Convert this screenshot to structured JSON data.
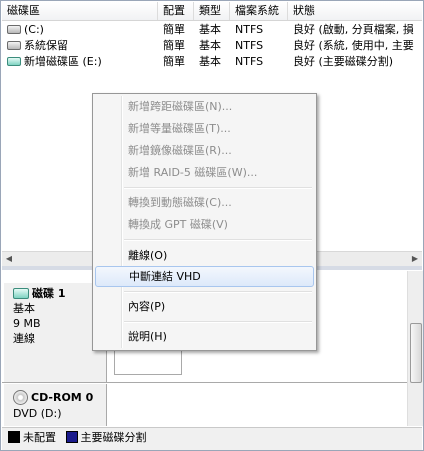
{
  "volume_list": {
    "columns": [
      "磁碟區",
      "配置",
      "類型",
      "檔案系統",
      "狀態"
    ],
    "rows": [
      {
        "name": "(C:)",
        "layout": "簡單",
        "type": "基本",
        "fs": "NTFS",
        "status": "良好 (啟動, 分頁檔案, 損",
        "icon": "drive-icon"
      },
      {
        "name": "系統保留",
        "layout": "簡單",
        "type": "基本",
        "fs": "NTFS",
        "status": "良好 (系統, 使用中, 主要",
        "icon": "drive-icon"
      },
      {
        "name": "新增磁碟區 (E:)",
        "layout": "簡單",
        "type": "基本",
        "fs": "NTFS",
        "status": "良好 (主要磁碟分割)",
        "icon": "vhd-drive-icon"
      }
    ]
  },
  "context_menu": {
    "items": [
      {
        "label": "新增跨距磁碟區(N)...",
        "enabled": false
      },
      {
        "label": "新增等量磁碟區(T)...",
        "enabled": false
      },
      {
        "label": "新增鏡像磁碟區(R)...",
        "enabled": false
      },
      {
        "label": "新增 RAID-5 磁碟區(W)...",
        "enabled": false
      },
      {
        "label": "轉換到動態磁碟(C)...",
        "enabled": false
      },
      {
        "label": "轉換成 GPT 磁碟(V)",
        "enabled": false
      },
      {
        "label": "離線(O)",
        "enabled": true
      },
      {
        "label": "中斷連結 VHD",
        "enabled": true,
        "highlighted": true
      },
      {
        "label": "內容(P)",
        "enabled": true
      },
      {
        "label": "說明(H)",
        "enabled": true
      }
    ]
  },
  "disks": [
    {
      "title": "磁碟 1",
      "type": "基本",
      "size": "9 MB",
      "status": "連線",
      "icon": "vhd-disk-icon"
    },
    {
      "title": "CD-ROM 0",
      "type": "DVD (D:)",
      "icon": "cdrom-icon"
    }
  ],
  "legend": [
    {
      "label": "未配置",
      "color": "#000000"
    },
    {
      "label": "主要磁碟分割",
      "color": "#1a1a8c"
    }
  ]
}
